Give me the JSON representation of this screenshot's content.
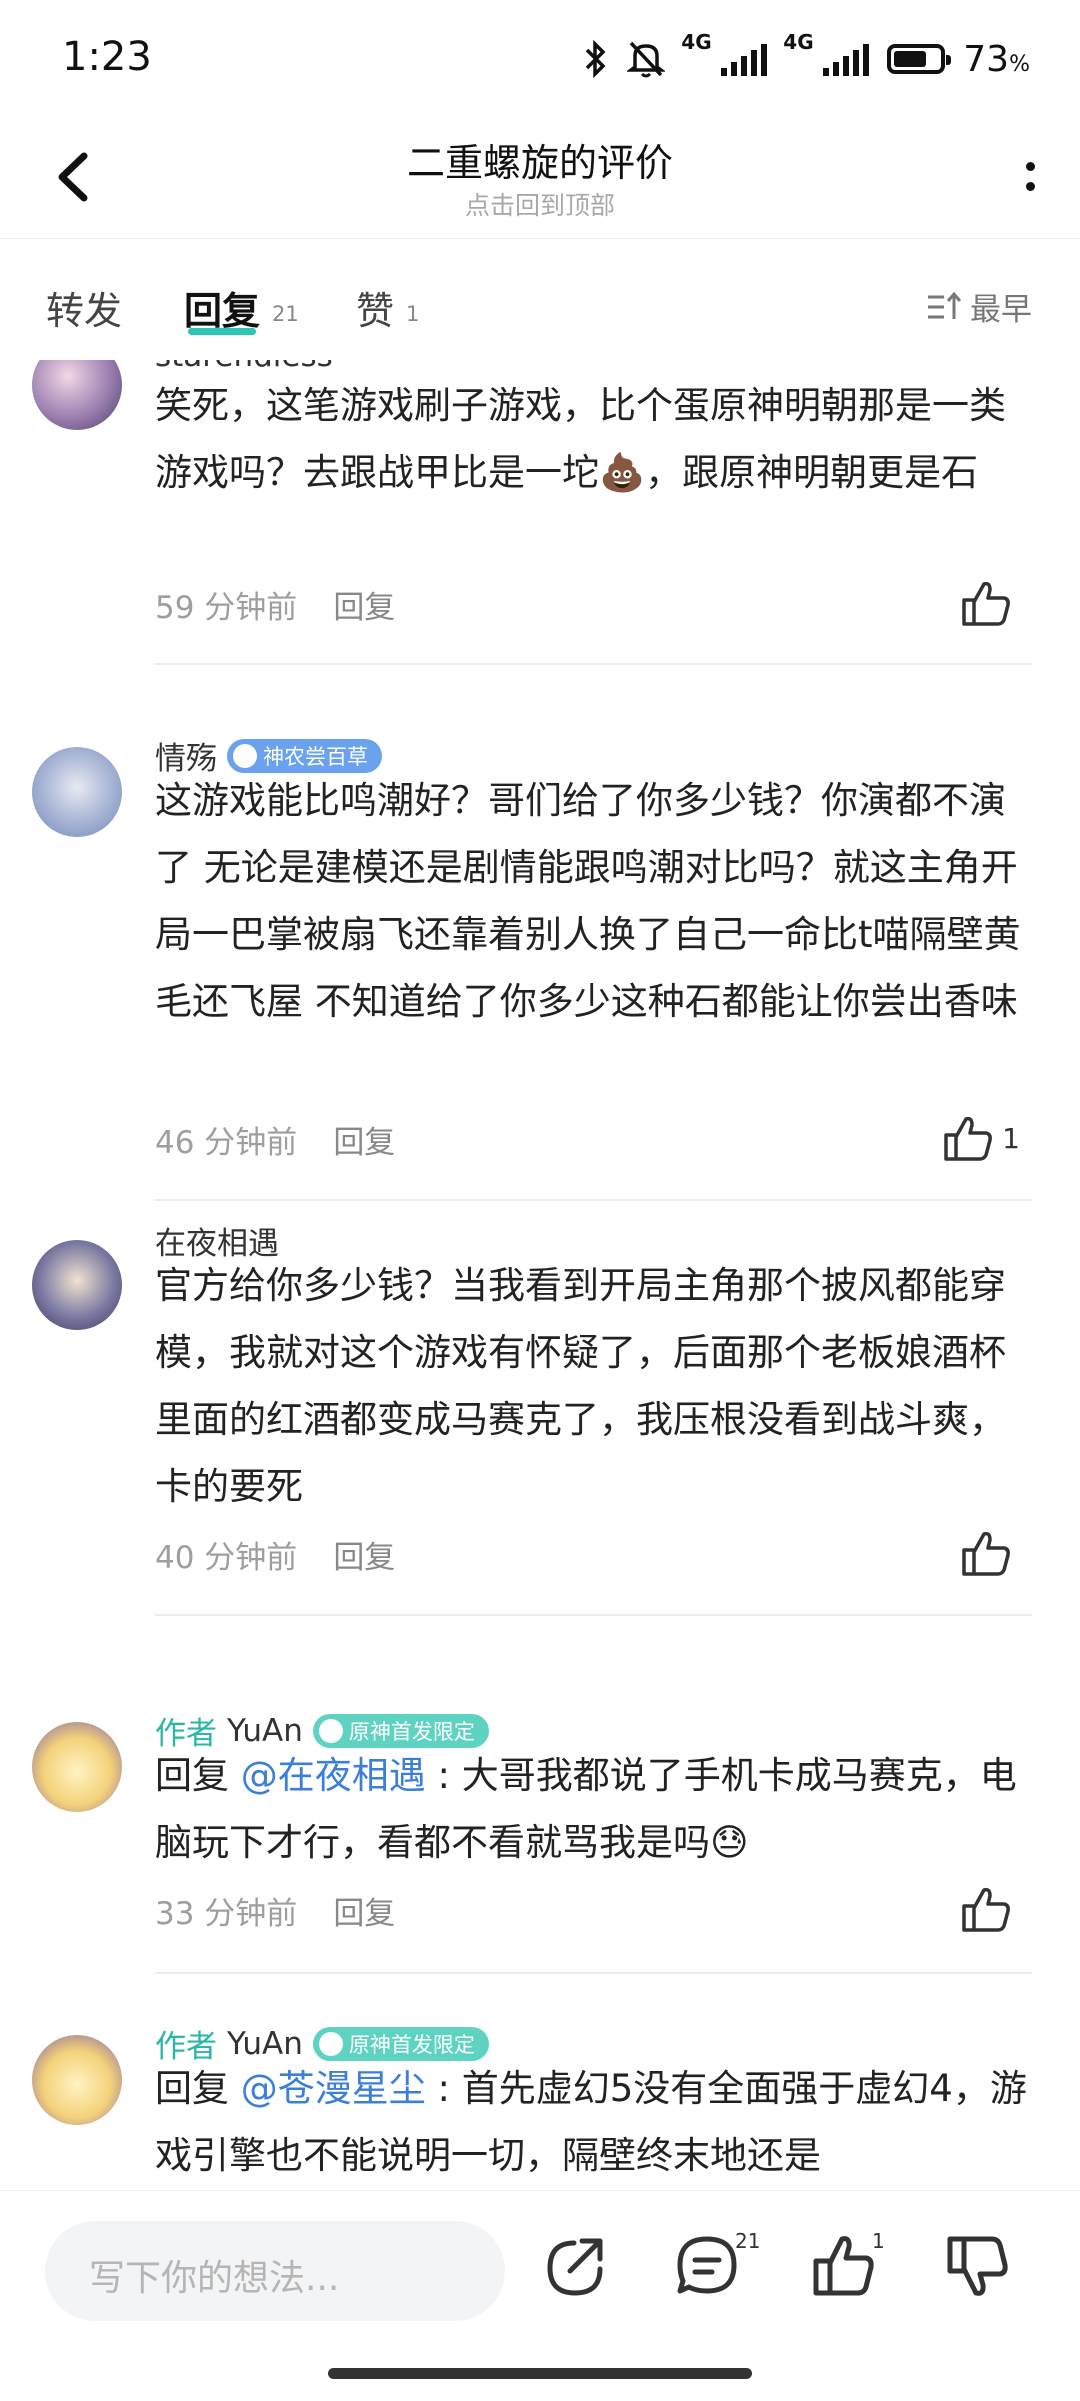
{
  "status_bar": {
    "time": "1:23",
    "signal1_label": "4G",
    "signal2_label": "4G",
    "battery_percent": "73",
    "battery_unit": "%",
    "battery_level": 0.73
  },
  "header": {
    "title": "二重螺旋的评价",
    "subtitle": "点击回到顶部"
  },
  "tabs": [
    {
      "label": "转发",
      "count": ""
    },
    {
      "label": "回复",
      "count": "21"
    },
    {
      "label": "赞",
      "count": "1"
    }
  ],
  "sort_label": "最早",
  "comments": [
    {
      "user": "starendless",
      "text": "笑死，这笔游戏刷子游戏，比个蛋原神明朝那是一类游戏吗？去跟战甲比是一坨💩，跟原神明朝更是石",
      "time": "59 分钟前",
      "reply_label": "回复",
      "likes": ""
    },
    {
      "user": "情殇",
      "badge": "神农尝百草",
      "text": "这游戏能比鸣潮好？哥们给了你多少钱？你演都不演了 无论是建模还是剧情能跟鸣潮对比吗？就这主角开局一巴掌被扇飞还靠着别人换了自己一命比t喵隔壁黄毛还飞屋 不知道给了你多少这种石都能让你尝出香味",
      "time": "46 分钟前",
      "reply_label": "回复",
      "likes": "1"
    },
    {
      "user": "在夜相遇",
      "text": "官方给你多少钱？当我看到开局主角那个披风都能穿模，我就对这个游戏有怀疑了，后面那个老板娘酒杯里面的红酒都变成马赛克了，我压根没看到战斗爽，卡的要死",
      "time": "40 分钟前",
      "reply_label": "回复",
      "likes": ""
    },
    {
      "author_label": "作者",
      "user": "YuAn",
      "badge": "原神首发限定",
      "reply_prefix": "回复 ",
      "mention": "@在夜相遇",
      "text": " : 大哥我都说了手机卡成马赛克，电脑玩下才行，看都不看就骂我是吗😓",
      "time": "33 分钟前",
      "reply_label": "回复",
      "likes": ""
    },
    {
      "author_label": "作者",
      "user": "YuAn",
      "badge": "原神首发限定",
      "reply_prefix": "回复 ",
      "mention": "@苍漫星尘",
      "text": " : 首先虚幻5没有全面强于虚幻4，游戏引擎也不能说明一切，隔壁终末地还是"
    }
  ],
  "bottom_bar": {
    "input_placeholder": "写下你的想法...",
    "comment_count": "21",
    "like_count": "1"
  },
  "colors": {
    "accent": "#2ec4b6",
    "author": "#2bb7a5",
    "mention": "#3b7fd6",
    "badge_blue": "#6aa2ee",
    "badge_teal": "#5fd3c2"
  }
}
